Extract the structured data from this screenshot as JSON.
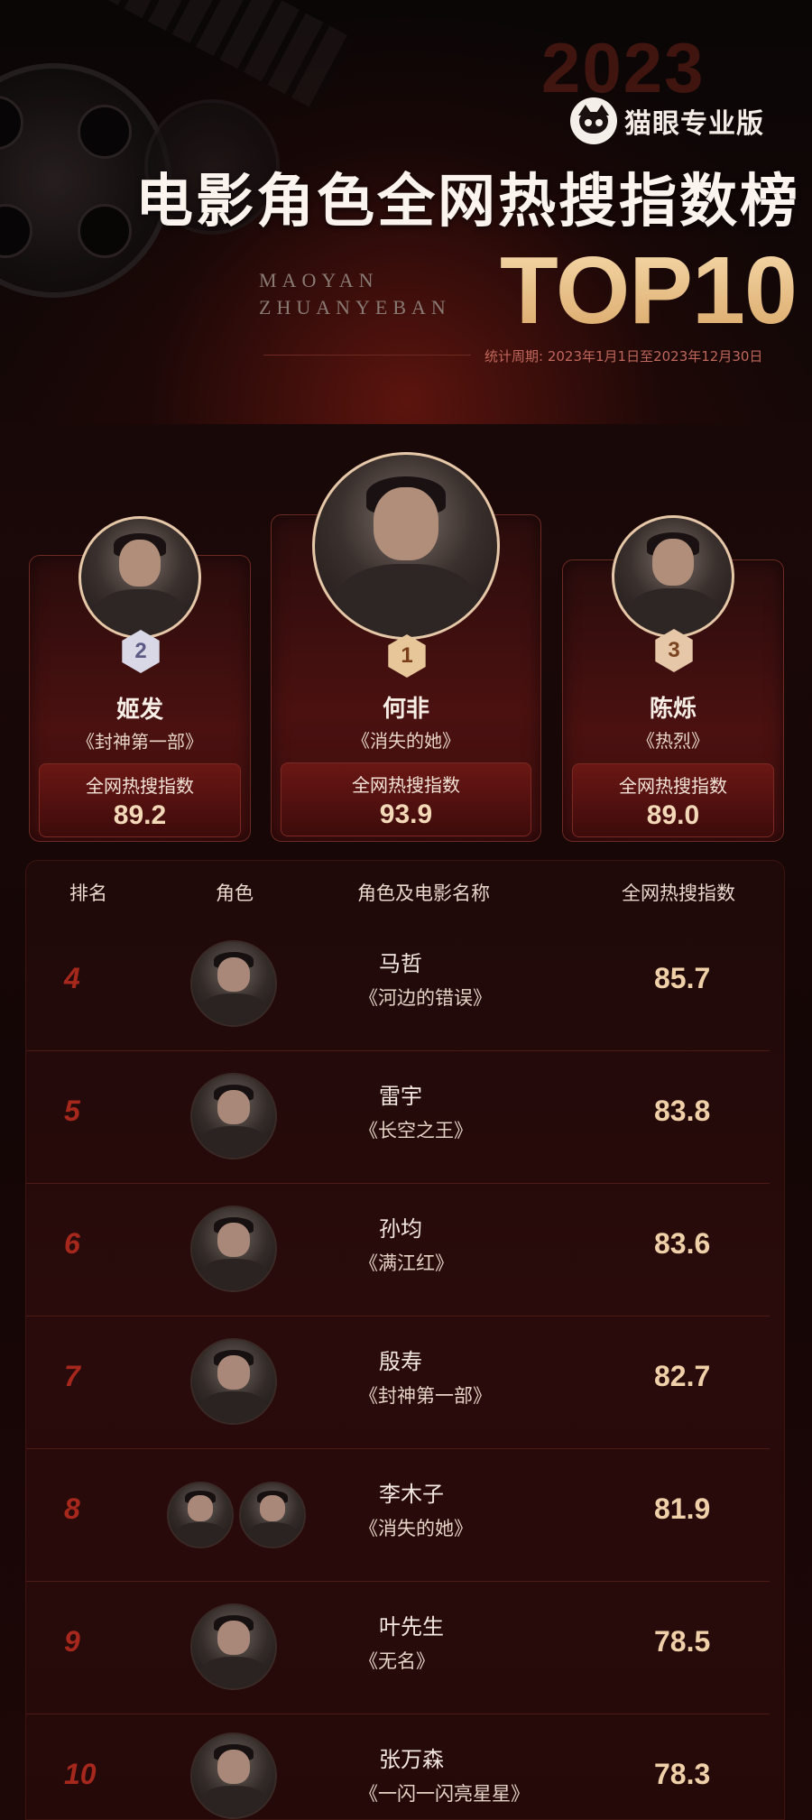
{
  "header": {
    "year": "2023",
    "brand": "猫眼专业版",
    "title": "电影角色全网热搜指数榜",
    "subtitle_en_line1": "MAOYAN",
    "subtitle_en_line2": "ZHUANYEBAN",
    "top_label": "TOP10",
    "period": "统计周期: 2023年1月1日至2023年12月30日"
  },
  "index_label": "全网热搜指数",
  "podium": [
    {
      "rank": "2",
      "name": "姬发",
      "film": "《封神第一部》",
      "value": "89.2"
    },
    {
      "rank": "1",
      "name": "何非",
      "film": "《消失的她》",
      "value": "93.9"
    },
    {
      "rank": "3",
      "name": "陈烁",
      "film": "《热烈》",
      "value": "89.0"
    }
  ],
  "table": {
    "headers": {
      "rank": "排名",
      "role": "角色",
      "name": "角色及电影名称",
      "index": "全网热搜指数"
    },
    "rows": [
      {
        "rank": "4",
        "name": "马哲",
        "film": "《河边的错误》",
        "value": "85.7"
      },
      {
        "rank": "5",
        "name": "雷宇",
        "film": "《长空之王》",
        "value": "83.8"
      },
      {
        "rank": "6",
        "name": "孙均",
        "film": "《满江红》",
        "value": "83.6"
      },
      {
        "rank": "7",
        "name": "殷寿",
        "film": "《封神第一部》",
        "value": "82.7"
      },
      {
        "rank": "8",
        "name": "李木子",
        "film": "《消失的她》",
        "value": "81.9"
      },
      {
        "rank": "9",
        "name": "叶先生",
        "film": "《无名》",
        "value": "78.5"
      },
      {
        "rank": "10",
        "name": "张万森",
        "film": "《一闪一闪亮星星》",
        "value": "78.3"
      }
    ]
  },
  "colors": {
    "accent_red": "#a6281d",
    "gold": "#ecc48a",
    "card_bg": "#4a1110"
  }
}
